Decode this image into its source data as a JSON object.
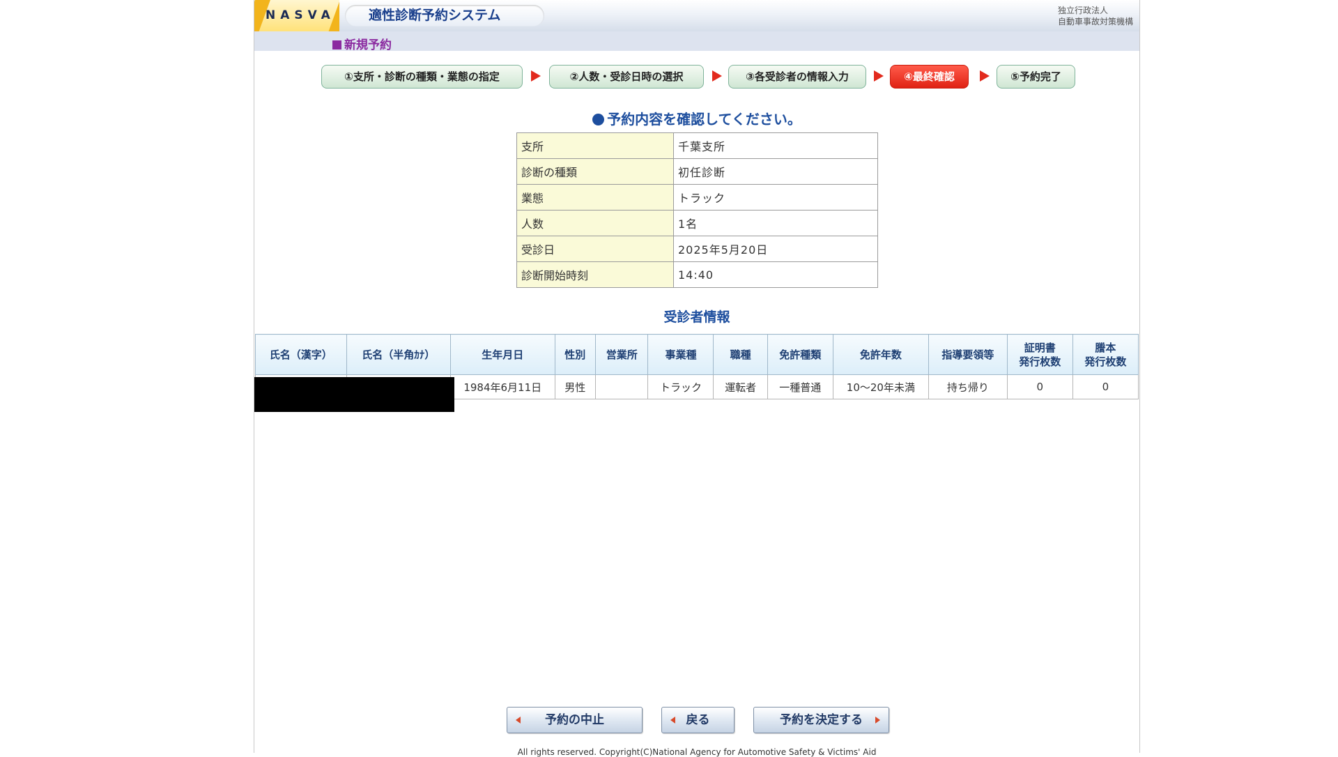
{
  "header": {
    "logo": "NASVA",
    "app_title": "適性診断予約システム",
    "org_line1": "独立行政法人",
    "org_line2": "自動車事故対策機構"
  },
  "section_title": "新規予約",
  "steps": [
    {
      "label": "①支所・診断の種類・業態の指定",
      "active": false
    },
    {
      "label": "②人数・受診日時の選択",
      "active": false
    },
    {
      "label": "③各受診者の情報入力",
      "active": false
    },
    {
      "label": "④最終確認",
      "active": true
    },
    {
      "label": "⑤予約完了",
      "active": false
    }
  ],
  "confirm_message": "予約内容を確認してください。",
  "summary": [
    {
      "key": "支所",
      "value": "千葉支所"
    },
    {
      "key": "診断の種類",
      "value": "初任診断"
    },
    {
      "key": "業態",
      "value": "トラック"
    },
    {
      "key": "人数",
      "value": "1名"
    },
    {
      "key": "受診日",
      "value": "2025年5月20日"
    },
    {
      "key": "診断開始時刻",
      "value": "14:40"
    }
  ],
  "patient_section_title": "受診者情報",
  "patient_table": {
    "headers": [
      "氏名（漢字）",
      "氏名（半角ｶﾅ）",
      "生年月日",
      "性別",
      "営業所",
      "事業種",
      "職種",
      "免許種類",
      "免許年数",
      "指導要領等",
      "証明書\n発行枚数",
      "謄本\n発行枚数"
    ],
    "rows": [
      [
        "",
        "",
        "1984年6月11日",
        "男性",
        "",
        "トラック",
        "運転者",
        "一種普通",
        "10～20年未満",
        "持ち帰り",
        "0",
        "0"
      ]
    ]
  },
  "buttons": {
    "cancel": "予約の中止",
    "back": "戻る",
    "confirm": "予約を決定する"
  },
  "footer": "All rights reserved. Copyright(C)National Agency for Automotive Safety & Victims' Aid",
  "colors": {
    "accent_blue": "#1d4e9e",
    "active_step": "#e02214",
    "section_purple": "#8b2aa0"
  }
}
